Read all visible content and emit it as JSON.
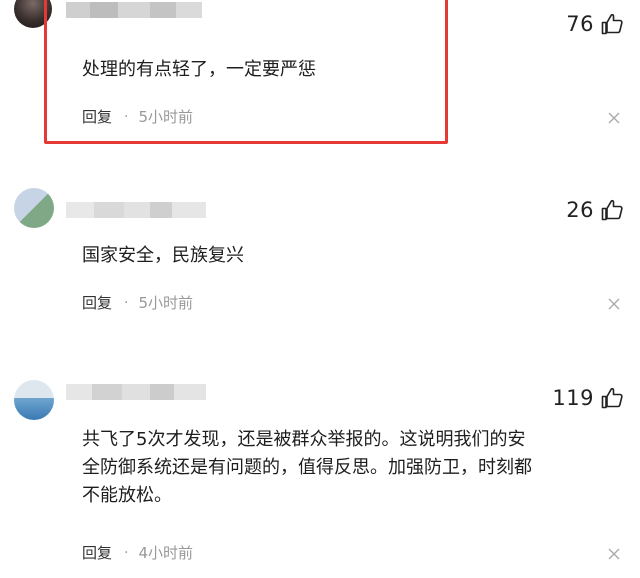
{
  "comments": [
    {
      "likes": "76",
      "text": "处理的有点轻了，一定要严惩",
      "reply_label": "回复",
      "separator": "·",
      "time": "5小时前",
      "highlighted": true
    },
    {
      "likes": "26",
      "text": "国家安全，民族复兴",
      "reply_label": "回复",
      "separator": "·",
      "time": "5小时前",
      "highlighted": false
    },
    {
      "likes": "119",
      "text_lines": [
        "共飞了5次才发现，还是被群众举报的。这说明我们的安",
        "全防御系统还是有问题的，值得反思。加强防卫，时刻都",
        "不能放松。"
      ],
      "reply_label": "回复",
      "separator": "·",
      "time": "4小时前",
      "highlighted": false
    }
  ],
  "colors": {
    "highlight_border": "#e53935",
    "muted_text": "#999999"
  },
  "icons": {
    "like": "thumbs-up-icon",
    "close": "close-icon"
  }
}
